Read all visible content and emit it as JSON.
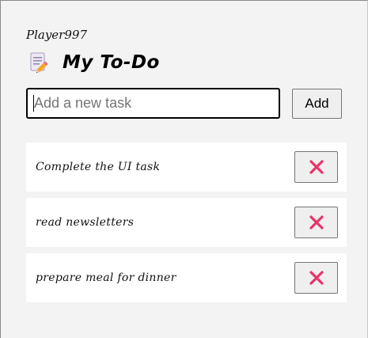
{
  "header": {
    "username": "Player997",
    "title": "My To-Do",
    "title_icon": "memo-icon"
  },
  "new_task": {
    "placeholder": "Add a new task",
    "value": "",
    "add_label": "Add"
  },
  "tasks": [
    {
      "label": "Complete the UI task",
      "delete_icon": "cross-mark-icon"
    },
    {
      "label": "read newsletters",
      "delete_icon": "cross-mark-icon"
    },
    {
      "label": "prepare meal for dinner",
      "delete_icon": "cross-mark-icon"
    }
  ],
  "colors": {
    "delete_icon": "#e8336b",
    "page_background": "#f3f3f3",
    "task_background": "#ffffff"
  }
}
